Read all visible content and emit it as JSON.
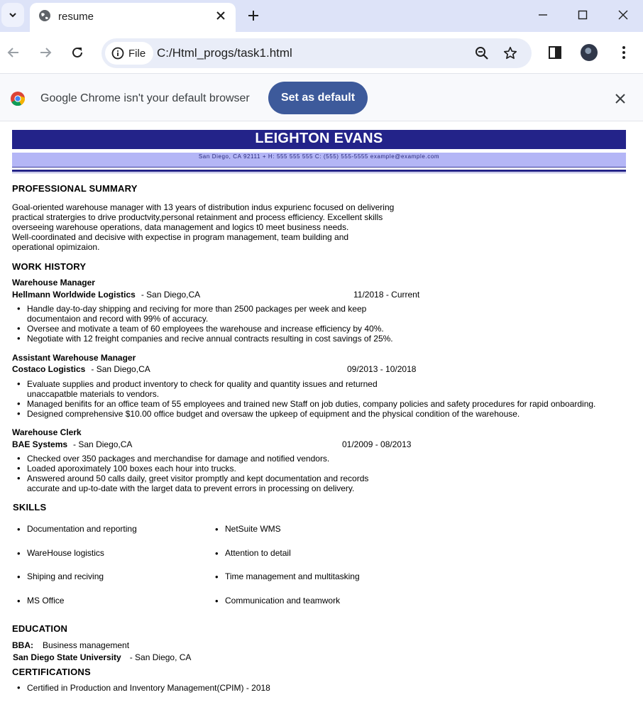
{
  "browser": {
    "tab": {
      "title": "resume"
    },
    "address": {
      "site_label": "File",
      "url": "C:/Html_progs/task1.html"
    },
    "infobar": {
      "message": "Google Chrome isn't your default browser",
      "button_label": "Set as default"
    }
  },
  "resume": {
    "name": "LEIGHTON EVANS",
    "contact": "San Diego, CA 92111 + H: 555 555 555 C: (555) 555-5555 example@example.com",
    "accent_color": "#232389",
    "contact_bar_color": "#b4b6f6",
    "summary": {
      "heading": "PROFESSIONAL SUMMARY",
      "lines": [
        "Goal-oriented warehouse manager with 13 years of distribution indus expurienc focused on delivering",
        "practical stratergies to drive productvity,personal retainment and process efficiency. Excellent skills",
        "overseeing warehouse operations, data management and logics t0 meet business needs.",
        "Well-coordinated and decisive with expectise in program management, team building and",
        "operational opimizaion."
      ]
    },
    "work_history": {
      "heading": "WORK HISTORY",
      "jobs": [
        {
          "title": "Warehouse Manager",
          "company": "Hellmann Worldwide Logistics",
          "location": "- San Diego,CA",
          "dates": "11/2018 - Current",
          "bullets": [
            "Handle day-to-day shipping and reciving for more than 2500 packages per week and keep",
            "documentaion and record with 99% of accuracy.",
            "Oversee and motivate a team of 60 employees the warehouse and increase efficiency by 40%.",
            "Negotiate with 12 freight companies and recive annual contracts resulting in cost savings of 25%."
          ]
        },
        {
          "title": "Assistant Warehouse Manager",
          "company": "Costaco Logistics",
          "location": "- San Diego,CA",
          "dates": "09/2013 - 10/2018",
          "bullets": [
            "Evaluate supplies and product inventory to check for quality and quantity issues and returned",
            "unaccapatble materials to vendors.",
            "Managed benifits for an office team of 55 employees and trained new Staff on job duties, company policies and safety procedures for rapid onboarding.",
            "Designed comprehensive $10.00 office budget and oversaw the upkeep of equipment and the physical condition of the warehouse."
          ]
        },
        {
          "title": "Warehouse Clerk",
          "company": "BAE Systems",
          "location": "- San Diego,CA",
          "dates": "01/2009 - 08/2013",
          "bullets": [
            "Checked over 350 packages and merchandise for damage and notified vendors.",
            "Loaded aporoximately 100 boxes each hour into trucks.",
            "Answered around 50 calls daily, greet visitor promptly and kept documentation and records",
            "accurate and up-to-date with the larget data to prevent errors in processing on delivery."
          ]
        }
      ]
    },
    "skills": {
      "heading": "SKILLS",
      "left": [
        "Documentation and reporting",
        "WareHouse logistics",
        "Shiping and reciving",
        "MS Office"
      ],
      "right": [
        "NetSuite WMS",
        "Attention to detail",
        "Time management and multitasking",
        "Communication and teamwork"
      ]
    },
    "education": {
      "heading": "EDUCATION",
      "degree_label": "BBA:",
      "degree_field": "Business management",
      "school": "San Diego State University",
      "location": "- San Diego, CA"
    },
    "certifications": {
      "heading": "CERTIFICATIONS",
      "items": [
        "Certified in Production and Inventory Management(CPIM) - 2018"
      ]
    }
  }
}
